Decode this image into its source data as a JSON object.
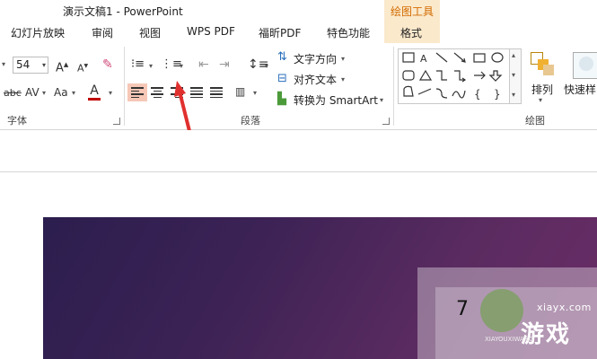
{
  "window": {
    "title": "演示文稿1 - PowerPoint"
  },
  "context_tab_group": {
    "label": "绘图工具"
  },
  "tabs": [
    {
      "label": "幻灯片放映"
    },
    {
      "label": "审阅"
    },
    {
      "label": "视图"
    },
    {
      "label": "WPS PDF"
    },
    {
      "label": "福昕PDF"
    },
    {
      "label": "特色功能"
    },
    {
      "label": "格式"
    }
  ],
  "font_group": {
    "font_size": "54",
    "label": "字体"
  },
  "paragraph_group": {
    "label": "段落",
    "text_direction": "文字方向",
    "align_text": "对齐文本",
    "convert_smartart": "转换为 SmartArt"
  },
  "drawing_group": {
    "label": "绘图",
    "arrange": "排列",
    "quick_styles": "快速样"
  },
  "slide": {
    "text": "7",
    "watermark_site": "xiayx.com",
    "watermark_name": "游戏",
    "watermark_en": "XIAYOUXIWANG"
  },
  "colors": {
    "accent_highlight": "#f6c7b6",
    "context_tab": "#d26b00",
    "arrow": "#e0302e"
  }
}
